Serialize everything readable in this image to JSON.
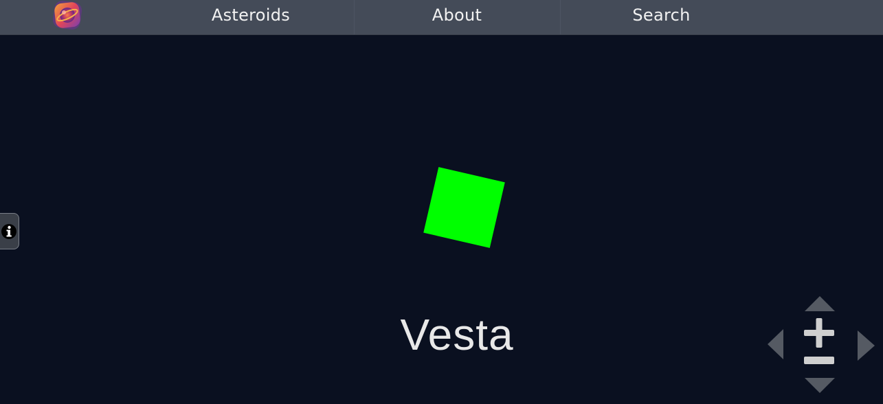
{
  "nav": {
    "logo_icon": "planet-logo-icon",
    "links": [
      {
        "label": "Asteroids"
      },
      {
        "label": "About"
      },
      {
        "label": "Search"
      }
    ]
  },
  "info_tab": {
    "icon": "info-icon"
  },
  "viewer": {
    "asteroid_name": "Vesta",
    "asteroid_color": "#00ff00",
    "background_color": "#0a1020"
  },
  "camera_controls": {
    "icons": [
      "pan-up-icon",
      "pan-left-icon",
      "zoom-in-icon",
      "zoom-out-icon",
      "pan-right-icon",
      "pan-down-icon"
    ],
    "color": "#cfcfcf"
  }
}
